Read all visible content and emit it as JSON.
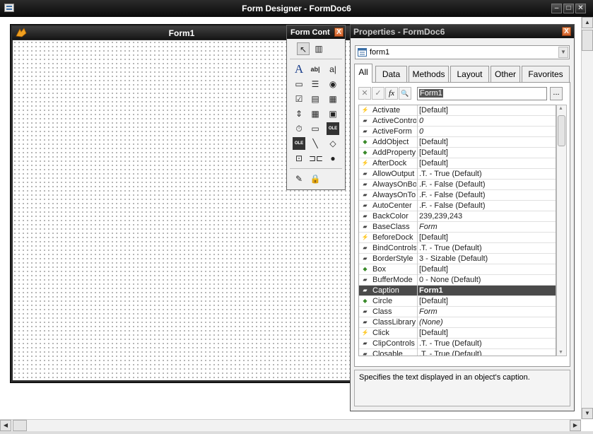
{
  "window": {
    "title": "Form Designer - FormDoc6",
    "min": "–",
    "max": "□",
    "close": "✕"
  },
  "form1": {
    "caption": "Form1",
    "icon": "fox-icon"
  },
  "form_controls": {
    "title": "Form Cont",
    "close": "X",
    "tools": [
      {
        "name": "pointer-tool-icon",
        "glyph": "↖"
      },
      {
        "name": "view-classes-tool-icon",
        "glyph": "▥"
      },
      {
        "name": "label-tool-icon",
        "glyph": "A"
      },
      {
        "name": "textbox-tool-icon",
        "glyph": "ab|"
      },
      {
        "name": "editbox-tool-icon",
        "glyph": "a|"
      },
      {
        "name": "commandbutton-tool-icon",
        "glyph": "▭"
      },
      {
        "name": "commandgroup-tool-icon",
        "glyph": "☰"
      },
      {
        "name": "optiongroup-tool-icon",
        "glyph": "◉"
      },
      {
        "name": "checkbox-tool-icon",
        "glyph": "☑"
      },
      {
        "name": "combobox-tool-icon",
        "glyph": "▤"
      },
      {
        "name": "listbox-tool-icon",
        "glyph": "▦"
      },
      {
        "name": "spinner-tool-icon",
        "glyph": "⇕"
      },
      {
        "name": "grid-tool-icon",
        "glyph": "▦"
      },
      {
        "name": "image-tool-icon",
        "glyph": "▣"
      },
      {
        "name": "timer-tool-icon",
        "glyph": "⏱"
      },
      {
        "name": "pageframe-tool-icon",
        "glyph": "▭"
      },
      {
        "name": "oleboundcontrol-tool-icon",
        "glyph": "OLE"
      },
      {
        "name": "olecontainer-tool-icon",
        "glyph": "OLE"
      },
      {
        "name": "line-tool-icon",
        "glyph": "╲"
      },
      {
        "name": "shape-tool-icon",
        "glyph": "◇"
      },
      {
        "name": "container-tool-icon",
        "glyph": "⊡"
      },
      {
        "name": "separator-tool-icon",
        "glyph": "⊐⊏"
      },
      {
        "name": "hyperlink-tool-icon",
        "glyph": "●"
      },
      {
        "name": "builder-lock-tool-icon",
        "glyph": "✎"
      },
      {
        "name": "button-lock-tool-icon",
        "glyph": "🔒"
      }
    ]
  },
  "properties": {
    "title": "Properties - FormDoc6",
    "close": "X",
    "object": "form1",
    "tabs": [
      "All",
      "Data",
      "Methods",
      "Layout",
      "Other",
      "Favorites"
    ],
    "active_tab": "All",
    "edit_value": "Form1",
    "toolbar": {
      "cancel": "✕",
      "accept": "✓",
      "fx": "fx",
      "zoom": "🔍",
      "ellipsis": "..."
    },
    "rows": [
      {
        "name": "Activate",
        "value": "[Default]",
        "kind": "event",
        "italic": false
      },
      {
        "name": "ActiveContro",
        "value": "0",
        "kind": "prop",
        "italic": true
      },
      {
        "name": "ActiveForm",
        "value": "0",
        "kind": "prop",
        "italic": true
      },
      {
        "name": "AddObject",
        "value": "[Default]",
        "kind": "method",
        "italic": false
      },
      {
        "name": "AddProperty",
        "value": "[Default]",
        "kind": "method",
        "italic": false
      },
      {
        "name": "AfterDock",
        "value": "[Default]",
        "kind": "event",
        "italic": false
      },
      {
        "name": "AllowOutput",
        "value": ".T. - True (Default)",
        "kind": "prop",
        "italic": false
      },
      {
        "name": "AlwaysOnBo",
        "value": ".F. - False (Default)",
        "kind": "prop",
        "italic": false
      },
      {
        "name": "AlwaysOnTo",
        "value": ".F. - False (Default)",
        "kind": "prop",
        "italic": false
      },
      {
        "name": "AutoCenter",
        "value": ".F. - False (Default)",
        "kind": "prop",
        "italic": false
      },
      {
        "name": "BackColor",
        "value": "239,239,243",
        "kind": "prop",
        "italic": false
      },
      {
        "name": "BaseClass",
        "value": "Form",
        "kind": "prop",
        "italic": true
      },
      {
        "name": "BeforeDock",
        "value": "[Default]",
        "kind": "event",
        "italic": false
      },
      {
        "name": "BindControls",
        "value": ".T. - True (Default)",
        "kind": "prop",
        "italic": false
      },
      {
        "name": "BorderStyle",
        "value": "3 - Sizable (Default)",
        "kind": "prop",
        "italic": false
      },
      {
        "name": "Box",
        "value": "[Default]",
        "kind": "method",
        "italic": false
      },
      {
        "name": "BufferMode",
        "value": "0 - None (Default)",
        "kind": "prop",
        "italic": false
      },
      {
        "name": "Caption",
        "value": "Form1",
        "kind": "prop",
        "italic": false,
        "selected": true
      },
      {
        "name": "Circle",
        "value": "[Default]",
        "kind": "method",
        "italic": false
      },
      {
        "name": "Class",
        "value": "Form",
        "kind": "prop",
        "italic": true
      },
      {
        "name": "ClassLibrary",
        "value": "(None)",
        "kind": "prop",
        "italic": true
      },
      {
        "name": "Click",
        "value": "[Default]",
        "kind": "event",
        "italic": false
      },
      {
        "name": "ClipControls",
        "value": ".T. - True (Default)",
        "kind": "prop",
        "italic": false
      },
      {
        "name": "Closable",
        "value": ".T. - True (Default)",
        "kind": "prop",
        "italic": false
      }
    ],
    "description": "Specifies the text displayed in an object's caption."
  },
  "colors": {
    "selected_row": "#4a4a4a",
    "event_icon": "#c9a400",
    "method_icon": "#3a8a2a",
    "prop_icon": "#444444"
  }
}
